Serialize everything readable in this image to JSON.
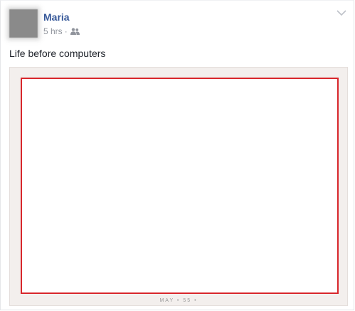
{
  "post": {
    "author": "Maria",
    "timestamp": "5 hrs",
    "separator": "·",
    "audience_icon": "friends-icon",
    "menu_icon": "chevron-down-icon",
    "text": "Life before computers",
    "photo": {
      "stamp_text": "MAY  •  55  •",
      "frame_color": "#d8262b",
      "paper_color": "#f3efed"
    }
  },
  "colors": {
    "author_link": "#365899",
    "meta_text": "#90949c",
    "body_text": "#1d2129"
  }
}
